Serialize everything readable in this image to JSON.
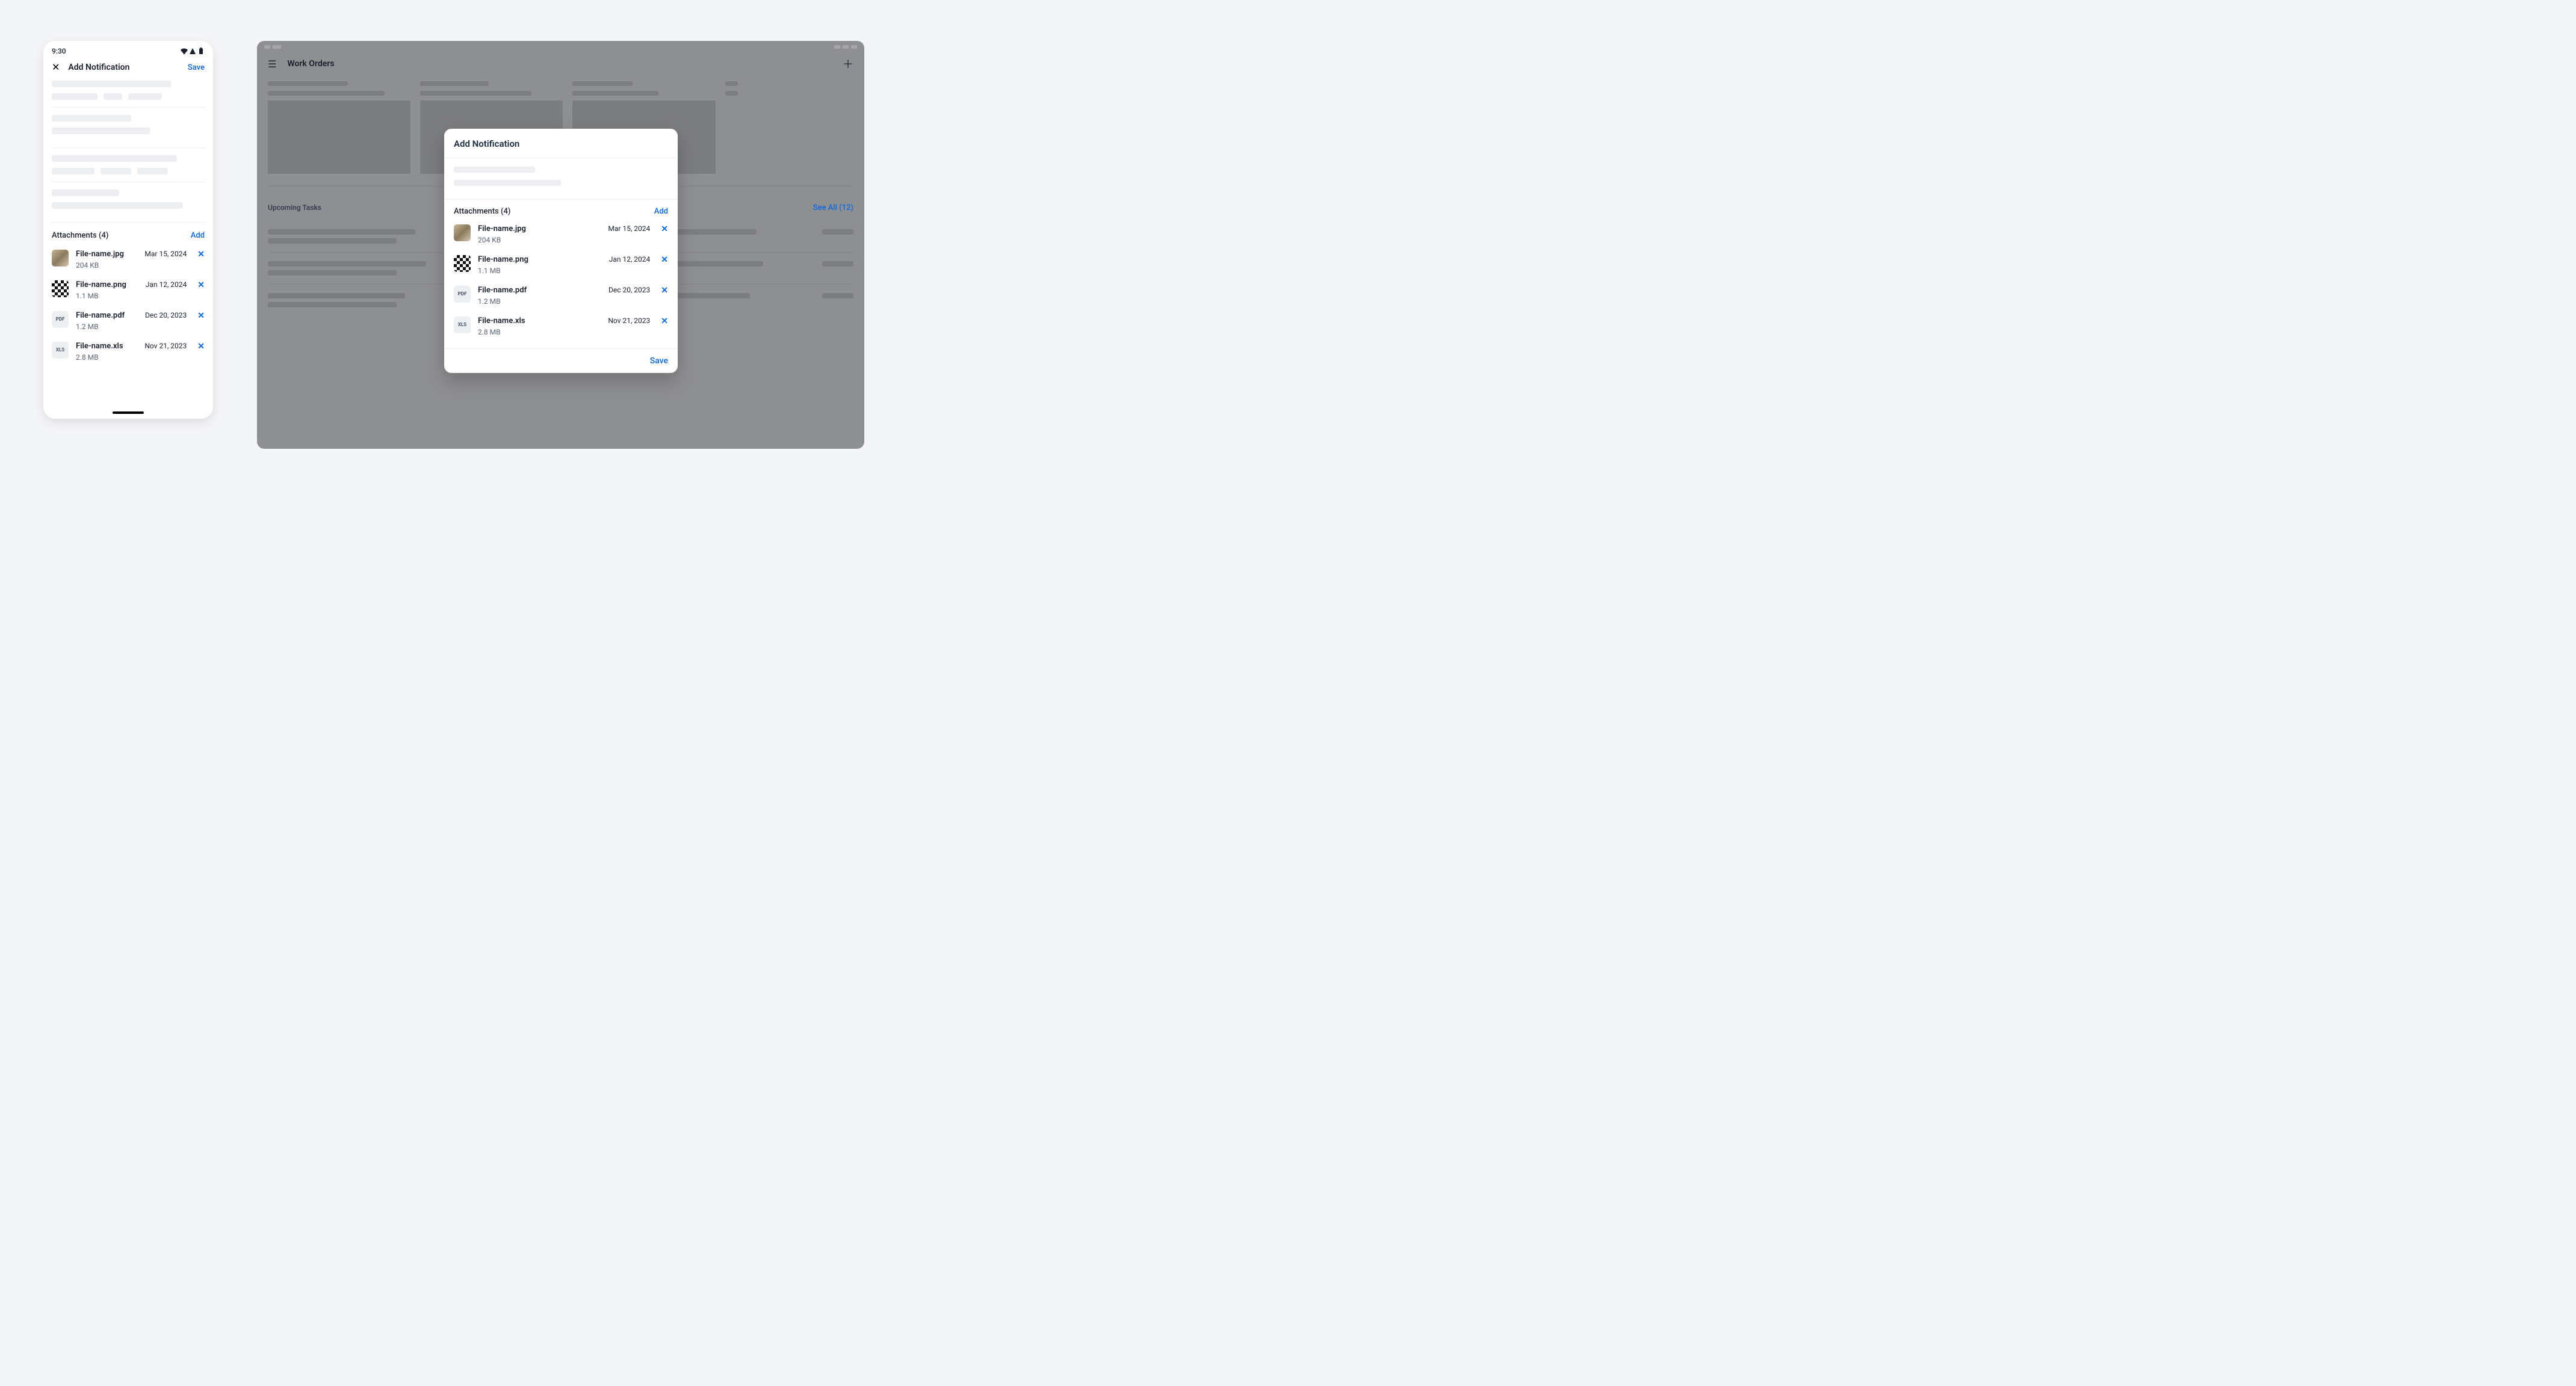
{
  "statusbar": {
    "time": "9:30"
  },
  "mobile": {
    "title": "Add Notification",
    "save": "Save",
    "attachments_label": "Attachments (4)",
    "add_label": "Add",
    "attachments": [
      {
        "name": "File-name.jpg",
        "size": "204 KB",
        "date": "Mar 15, 2024",
        "kind": "jpg"
      },
      {
        "name": "File-name.png",
        "size": "1.1 MB",
        "date": "Jan 12, 2024",
        "kind": "png"
      },
      {
        "name": "File-name.pdf",
        "size": "1.2 MB",
        "date": "Dec 20, 2023",
        "kind": "pdf",
        "icon_text": "PDF"
      },
      {
        "name": "File-name.xls",
        "size": "2.8 MB",
        "date": "Nov 21, 2023",
        "kind": "xls",
        "icon_text": "XLS"
      }
    ]
  },
  "tablet": {
    "title": "Work Orders",
    "upcoming_label": "Upcoming Tasks",
    "see_all": "See All (12)"
  },
  "dialog": {
    "title": "Add Notification",
    "attachments_label": "Attachments (4)",
    "add_label": "Add",
    "save": "Save",
    "attachments": [
      {
        "name": "File-name.jpg",
        "size": "204 KB",
        "date": "Mar 15, 2024",
        "kind": "jpg"
      },
      {
        "name": "File-name.png",
        "size": "1.1 MB",
        "date": "Jan 12, 2024",
        "kind": "png"
      },
      {
        "name": "File-name.pdf",
        "size": "1.2 MB",
        "date": "Dec 20, 2023",
        "kind": "pdf",
        "icon_text": "PDF"
      },
      {
        "name": "File-name.xls",
        "size": "2.8 MB",
        "date": "Nov 21, 2023",
        "kind": "xls",
        "icon_text": "XLS"
      }
    ]
  }
}
